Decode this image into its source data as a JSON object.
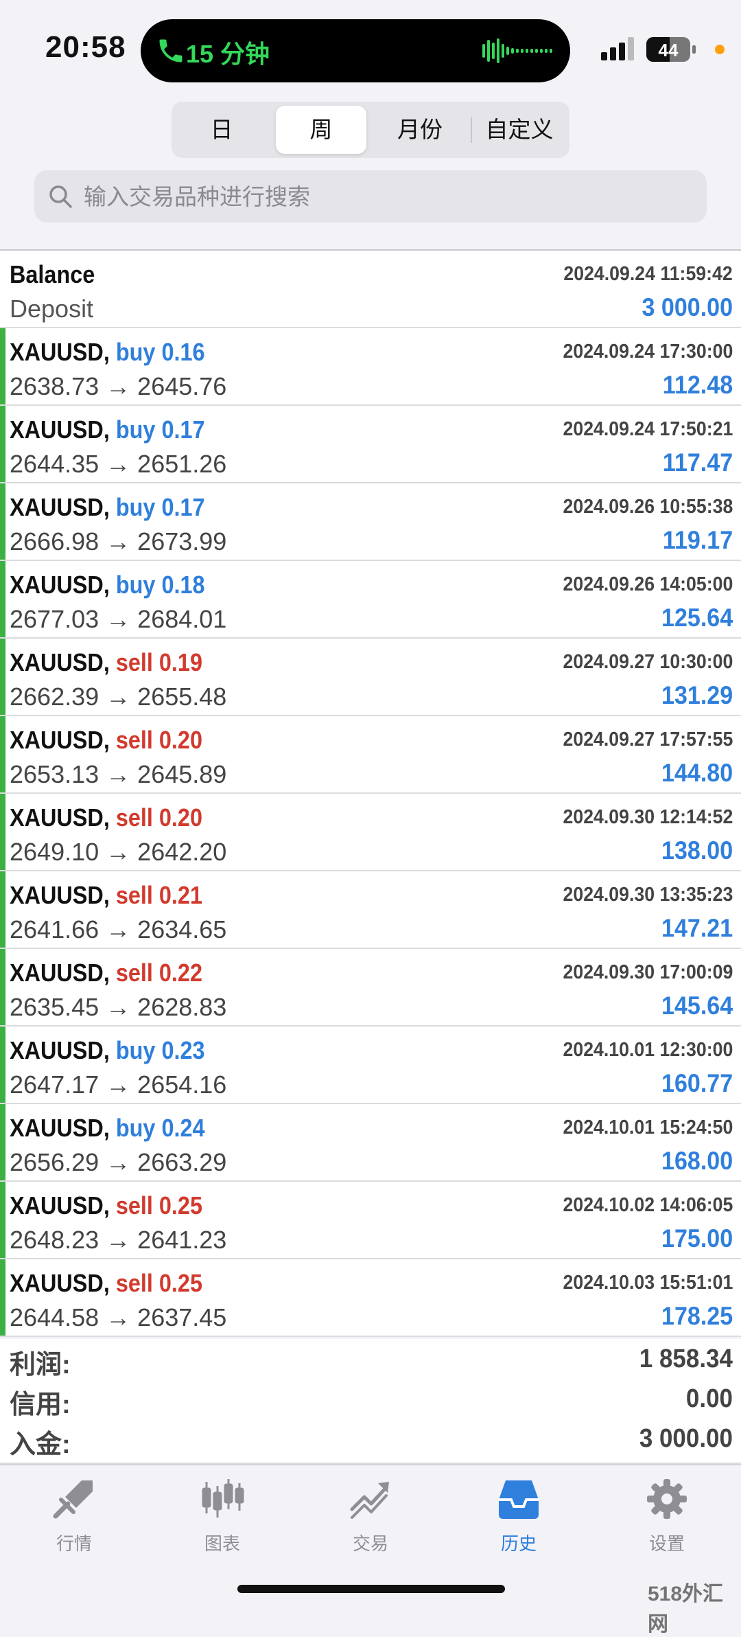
{
  "status_bar": {
    "time": "20:58",
    "call_label": "15 分钟",
    "battery": "44"
  },
  "period_tabs": [
    {
      "label": "日",
      "active": false
    },
    {
      "label": "周",
      "active": true
    },
    {
      "label": "月份",
      "active": false
    },
    {
      "label": "自定义",
      "active": false
    }
  ],
  "search": {
    "placeholder": "输入交易品种进行搜索"
  },
  "balance": {
    "title": "Balance",
    "time": "2024.09.24 11:59:42",
    "type": "Deposit",
    "amount": "3 000.00"
  },
  "deals": [
    {
      "symbol": "XAUUSD,",
      "direction": "buy",
      "volume": "0.16",
      "time": "2024.09.24 17:30:00",
      "open": "2638.73",
      "close": "2645.76",
      "profit": "112.48"
    },
    {
      "symbol": "XAUUSD,",
      "direction": "buy",
      "volume": "0.17",
      "time": "2024.09.24 17:50:21",
      "open": "2644.35",
      "close": "2651.26",
      "profit": "117.47"
    },
    {
      "symbol": "XAUUSD,",
      "direction": "buy",
      "volume": "0.17",
      "time": "2024.09.26 10:55:38",
      "open": "2666.98",
      "close": "2673.99",
      "profit": "119.17"
    },
    {
      "symbol": "XAUUSD,",
      "direction": "buy",
      "volume": "0.18",
      "time": "2024.09.26 14:05:00",
      "open": "2677.03",
      "close": "2684.01",
      "profit": "125.64"
    },
    {
      "symbol": "XAUUSD,",
      "direction": "sell",
      "volume": "0.19",
      "time": "2024.09.27 10:30:00",
      "open": "2662.39",
      "close": "2655.48",
      "profit": "131.29"
    },
    {
      "symbol": "XAUUSD,",
      "direction": "sell",
      "volume": "0.20",
      "time": "2024.09.27 17:57:55",
      "open": "2653.13",
      "close": "2645.89",
      "profit": "144.80"
    },
    {
      "symbol": "XAUUSD,",
      "direction": "sell",
      "volume": "0.20",
      "time": "2024.09.30 12:14:52",
      "open": "2649.10",
      "close": "2642.20",
      "profit": "138.00"
    },
    {
      "symbol": "XAUUSD,",
      "direction": "sell",
      "volume": "0.21",
      "time": "2024.09.30 13:35:23",
      "open": "2641.66",
      "close": "2634.65",
      "profit": "147.21"
    },
    {
      "symbol": "XAUUSD,",
      "direction": "sell",
      "volume": "0.22",
      "time": "2024.09.30 17:00:09",
      "open": "2635.45",
      "close": "2628.83",
      "profit": "145.64"
    },
    {
      "symbol": "XAUUSD,",
      "direction": "buy",
      "volume": "0.23",
      "time": "2024.10.01 12:30:00",
      "open": "2647.17",
      "close": "2654.16",
      "profit": "160.77"
    },
    {
      "symbol": "XAUUSD,",
      "direction": "buy",
      "volume": "0.24",
      "time": "2024.10.01 15:24:50",
      "open": "2656.29",
      "close": "2663.29",
      "profit": "168.00"
    },
    {
      "symbol": "XAUUSD,",
      "direction": "sell",
      "volume": "0.25",
      "time": "2024.10.02 14:06:05",
      "open": "2648.23",
      "close": "2641.23",
      "profit": "175.00"
    },
    {
      "symbol": "XAUUSD,",
      "direction": "sell",
      "volume": "0.25",
      "time": "2024.10.03 15:51:01",
      "open": "2644.58",
      "close": "2637.45",
      "profit": "178.25"
    }
  ],
  "arrow": "→",
  "summary": [
    {
      "label": "利润:",
      "value": "1 858.34"
    },
    {
      "label": "信用:",
      "value": "0.00"
    },
    {
      "label": "入金:",
      "value": "3 000.00"
    }
  ],
  "tabbar": [
    {
      "label": "行情",
      "icon": "quotes-icon",
      "active": false
    },
    {
      "label": "图表",
      "icon": "chart-icon",
      "active": false
    },
    {
      "label": "交易",
      "icon": "trade-icon",
      "active": false
    },
    {
      "label": "历史",
      "icon": "history-icon",
      "active": true
    },
    {
      "label": "设置",
      "icon": "settings-icon",
      "active": false
    }
  ],
  "watermark": "518外汇网",
  "colors": {
    "buy": "#2f7fdc",
    "sell": "#d23a2d",
    "profit": "#2f7fdc",
    "row_marker": "#3cb043",
    "tab_active": "#2f7fdc"
  }
}
